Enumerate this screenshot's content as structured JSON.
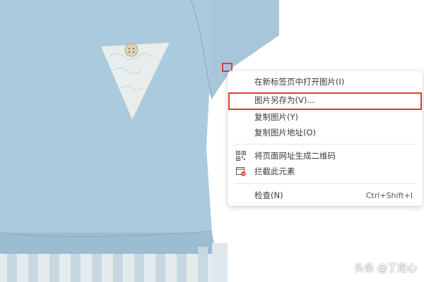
{
  "context_menu": {
    "items": [
      {
        "label": "在新标签页中打开图片(I)"
      },
      {
        "label": "图片另存为(V)..."
      },
      {
        "label": "复制图片(Y)"
      },
      {
        "label": "复制图片地址(O)"
      },
      {
        "label": "将页面网址生成二维码",
        "icon": "qr-code-icon"
      },
      {
        "label": "拦截此元素",
        "icon": "block-element-icon"
      },
      {
        "label": "检查(N)",
        "shortcut": "Ctrl+Shift+I"
      }
    ]
  },
  "watermark": {
    "text": "头条 @丁走心"
  },
  "colors": {
    "shirt": "#a9c8dc",
    "highlight": "#e53935",
    "menu_bg": "#ffffff"
  }
}
